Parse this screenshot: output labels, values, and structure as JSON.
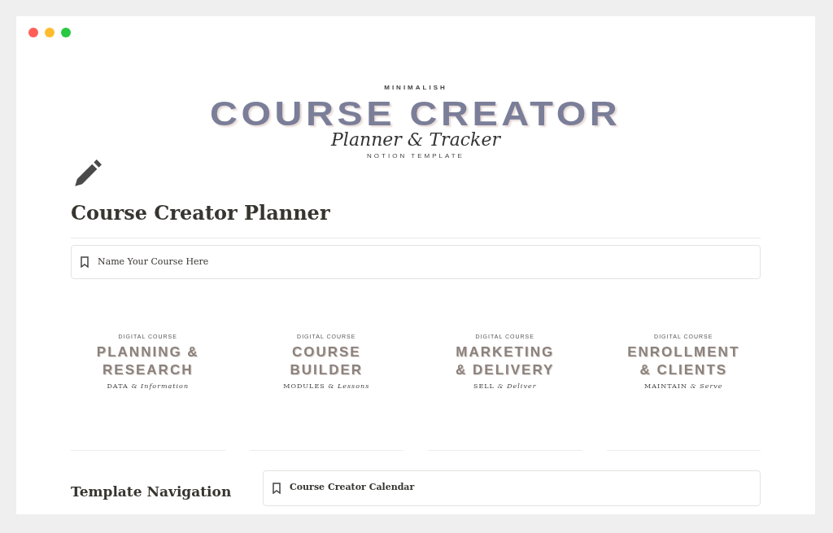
{
  "cover": {
    "kicker": "MINIMALISH",
    "title": "COURSE CREATOR",
    "script": "Planner & Tracker",
    "footer": "NOTION TEMPLATE"
  },
  "page": {
    "title": "Course Creator Planner"
  },
  "callout": {
    "text": "Name Your Course Here"
  },
  "cards": [
    {
      "kicker": "DIGITAL COURSE",
      "lines": [
        "PLANNING &",
        "RESEARCH"
      ],
      "tagline": "DATA & *Information*"
    },
    {
      "kicker": "DIGITAL COURSE",
      "lines": [
        "COURSE",
        "BUILDER"
      ],
      "tagline": "MODULES & *Lessons*"
    },
    {
      "kicker": "DIGITAL COURSE",
      "lines": [
        "MARKETING",
        "& DELIVERY"
      ],
      "tagline": "SELL *& Deliver*"
    },
    {
      "kicker": "DIGITAL COURSE",
      "lines": [
        "ENROLLMENT",
        "& CLIENTS"
      ],
      "tagline": "MAINTAIN *& Serve*"
    }
  ],
  "navigation": {
    "heading": "Template Navigation"
  },
  "calendar_link": {
    "text": "Course Creator Calendar"
  }
}
